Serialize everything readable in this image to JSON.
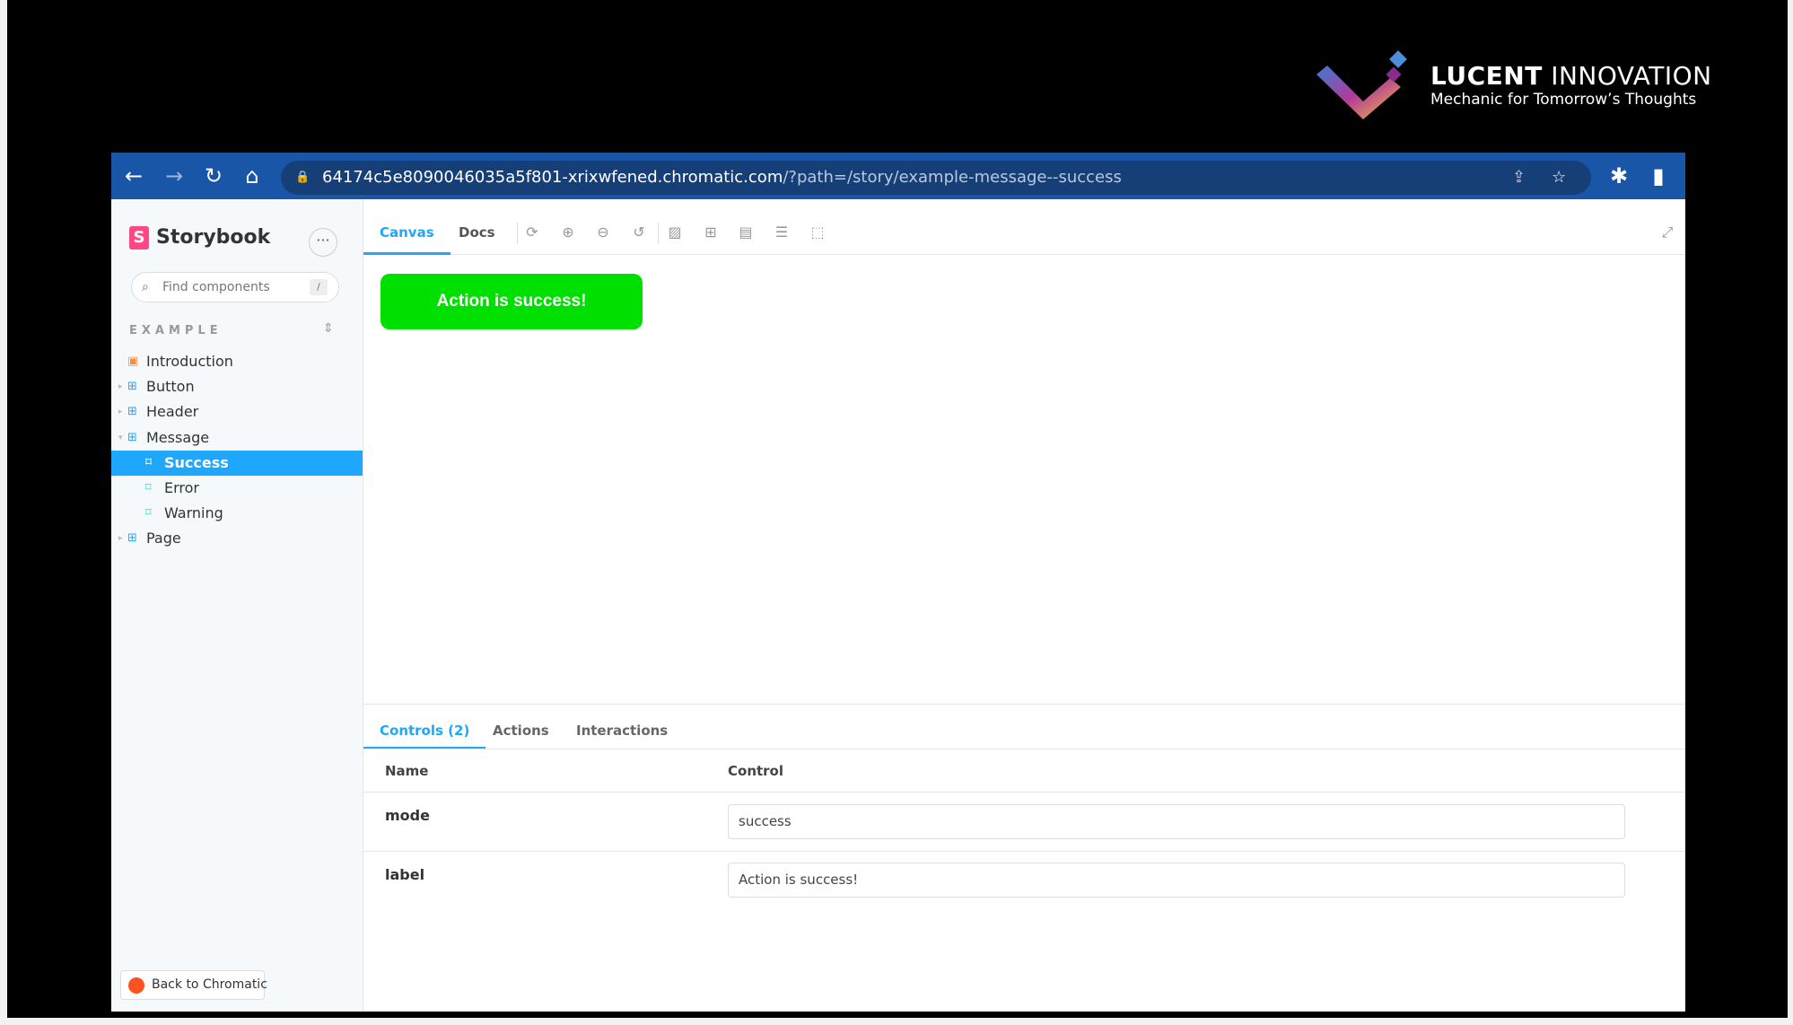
{
  "brand": {
    "name_bold": "LUCENT",
    "name_light": "INNOVATION",
    "tagline": "Mechanic for Tomorrow’s Thoughts"
  },
  "browser": {
    "url_host": "64174c5e8090046035a5f801-xrixwfened.chromatic.com",
    "url_path": "/?path=/story/example-message--success",
    "icons": [
      "back-arrow-icon",
      "forward-arrow-icon",
      "reload-icon",
      "home-icon",
      "lock-icon",
      "share-icon",
      "star-icon",
      "extensions-icon",
      "sidepanel-icon"
    ]
  },
  "sidebar": {
    "title": "Storybook",
    "more": "···",
    "search_placeholder": "Find components",
    "search_shortcut": "/",
    "group": "EXAMPLE",
    "items": [
      {
        "label": "Introduction",
        "type": "doc"
      },
      {
        "label": "Button",
        "type": "component"
      },
      {
        "label": "Header",
        "type": "component"
      },
      {
        "label": "Message",
        "type": "component",
        "expanded": true
      },
      {
        "label": "Success",
        "type": "story",
        "selected": true
      },
      {
        "label": "Error",
        "type": "story"
      },
      {
        "label": "Warning",
        "type": "story"
      },
      {
        "label": "Page",
        "type": "component"
      }
    ],
    "back_button": "Back to Chromatic"
  },
  "toolbar": {
    "tabs": [
      "Canvas",
      "Docs"
    ],
    "active_tab": "Canvas"
  },
  "canvas": {
    "message": "Action is success!",
    "message_color": "#00e000"
  },
  "addons": {
    "tabs": [
      "Controls (2)",
      "Actions",
      "Interactions"
    ],
    "active_tab": "Controls (2)",
    "headers": {
      "name": "Name",
      "control": "Control"
    },
    "rows": [
      {
        "name": "mode",
        "value": "success"
      },
      {
        "name": "label",
        "value": "Action is success!"
      }
    ]
  },
  "colors": {
    "accent": "#1ea7fd",
    "chrome": "#1a56a8",
    "storybook": "#ff4785"
  }
}
